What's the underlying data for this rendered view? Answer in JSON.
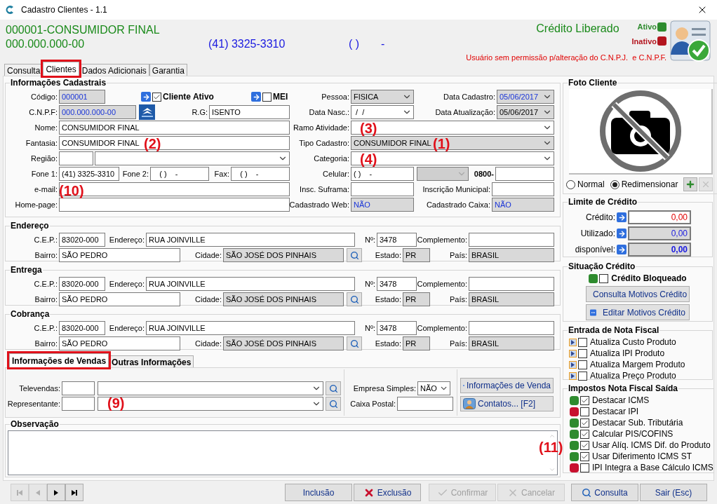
{
  "window": {
    "title": "Cadastro Clientes  - 1.1"
  },
  "header": {
    "customer": "000001-CONSUMIDOR FINAL",
    "document": "000.000.000-00",
    "phone": "(41) 3325-3310",
    "phone_2": "( )",
    "phone_2_separator": "-",
    "credit_status": "Crédito Liberado",
    "legend": [
      {
        "label": "Ativo",
        "color": "#2e8b2e"
      },
      {
        "label": "Inativo",
        "color": "#b3141e"
      }
    ],
    "warning": "Usuário sem permissão p/alteração do C.N.P.J.  e C.N.P.F."
  },
  "tabs": [
    {
      "label": "Consulta",
      "selected": false,
      "highlighted": false
    },
    {
      "label": "Clientes",
      "selected": true,
      "highlighted": true
    },
    {
      "label": "Dados Adicionais",
      "selected": false,
      "highlighted": false
    },
    {
      "label": "Garantia",
      "selected": false,
      "highlighted": false
    }
  ],
  "registration": {
    "title": "Informações Cadastrais",
    "lines": [
      {
        "fields": [
          {
            "kind": "text",
            "label": "Código:",
            "value": "000001",
            "readonly": true,
            "highlighted": true
          },
          {
            "kind": "check",
            "label": "Cliente Ativo",
            "checked": true
          },
          {
            "kind": "check",
            "label": "MEI",
            "checked": false
          },
          {
            "kind": "combo",
            "label": "Pessoa:",
            "value": "FISICA",
            "readonly": true,
            "highlighted": false
          },
          {
            "kind": "combo",
            "label": "Data Cadastro:",
            "value": "05/06/2017",
            "readonly": true,
            "highlighted": true
          }
        ]
      },
      {
        "fields": [
          {
            "kind": "text",
            "label": "C.N.P.F:",
            "value": "000.000.000-00",
            "readonly": true,
            "highlighted": true
          },
          {
            "kind": "icon_button"
          },
          {
            "kind": "text",
            "label": "R.G:",
            "value": "ISENTO",
            "readonly": false,
            "highlighted": false
          },
          {
            "kind": "combo",
            "label": "Data Nasc.:",
            "value": " /  /",
            "readonly": false,
            "highlighted": false
          },
          {
            "kind": "combo",
            "label": "Data Atualização:",
            "value": "05/06/2017",
            "readonly": true,
            "highlighted": false
          }
        ]
      },
      {
        "fields": [
          {
            "kind": "text",
            "label": "Nome:",
            "value": "CONSUMIDOR FINAL",
            "readonly": false,
            "highlighted": false
          },
          {
            "kind": "combo",
            "label": "Ramo Atividade:",
            "readonly": false
          }
        ]
      },
      {
        "fields": [
          {
            "kind": "text",
            "label": "Fantasia:",
            "value": "CONSUMIDOR FINAL",
            "readonly": false,
            "highlighted": false
          },
          {
            "kind": "combo",
            "label": "Tipo Cadastro:",
            "value": "CONSUMIDOR FINAL",
            "readonly": true,
            "highlighted": false
          }
        ]
      },
      {
        "fields": [
          {
            "kind": "text",
            "label": "Região:",
            "readonly": false
          },
          {
            "kind": "combo",
            "readonly": false
          },
          {
            "kind": "combo",
            "label": "Categoria:",
            "readonly": false
          }
        ]
      },
      {
        "fields": [
          {
            "kind": "text",
            "label": "Fone 1:",
            "value": "(41) 3325-3310",
            "readonly": false,
            "highlighted": false
          },
          {
            "kind": "text",
            "label": "Fone 2:",
            "value": "   ( )    -",
            "readonly": false,
            "highlighted": false
          },
          {
            "kind": "text",
            "label": "Fax:",
            "value": "   ( )    -",
            "readonly": false,
            "highlighted": false
          },
          {
            "kind": "text",
            "label": "Celular:",
            "value": "( )    -",
            "readonly": false,
            "highlighted": false
          },
          {
            "kind": "combo",
            "disabled": true
          },
          {
            "kind": "prefixed",
            "label": "0800-",
            "readonly": false
          }
        ]
      },
      {
        "fields": [
          {
            "kind": "text",
            "label": "e-mail:",
            "readonly": false
          },
          {
            "kind": "text",
            "label": "Insc. Suframa:",
            "readonly": false
          },
          {
            "kind": "text",
            "label": "Inscrição Municipal:",
            "readonly": false
          }
        ]
      },
      {
        "fields": [
          {
            "kind": "text",
            "label": "Home-page:",
            "readonly": false
          },
          {
            "kind": "text",
            "label": "Cadastrado Web:",
            "value": "NÃO",
            "readonly": true,
            "highlighted": true
          },
          {
            "kind": "text",
            "label": "Cadastrado Caixa:",
            "value": "NÃO",
            "readonly": true,
            "highlighted": true
          }
        ]
      }
    ]
  },
  "addresses": [
    {
      "title": "Endereço",
      "lines": [
        {
          "fields": [
            {
              "kind": "text",
              "label": "C.E.P.:",
              "value": "83020-000",
              "readonly": false,
              "highlighted": false
            },
            {
              "kind": "text",
              "label": "Endereço:",
              "value": "RUA JOINVILLE",
              "readonly": false,
              "highlighted": false
            },
            {
              "kind": "text",
              "label": "Nº:",
              "value": "3478",
              "readonly": false,
              "highlighted": false
            },
            {
              "kind": "text",
              "label": "Complemento:",
              "readonly": false
            }
          ]
        },
        {
          "fields": [
            {
              "kind": "text",
              "label": "Bairro:",
              "value": "SÃO PEDRO",
              "readonly": false,
              "highlighted": false
            },
            {
              "kind": "text",
              "label": "Cidade:",
              "value": "SÃO JOSÉ DOS PINHAIS",
              "readonly": true,
              "highlighted": false
            },
            {
              "kind": "search_button"
            },
            {
              "kind": "text",
              "label": "Estado:",
              "value": "PR",
              "readonly": true,
              "highlighted": false
            },
            {
              "kind": "text",
              "label": "País:",
              "value": "BRASIL",
              "readonly": true,
              "highlighted": false
            }
          ]
        }
      ]
    },
    {
      "title": "Entrega",
      "lines": [
        {
          "fields": [
            {
              "kind": "text",
              "label": "C.E.P.:",
              "value": "83020-000",
              "readonly": false,
              "highlighted": false
            },
            {
              "kind": "text",
              "label": "Endereço:",
              "value": "RUA JOINVILLE",
              "readonly": false,
              "highlighted": false
            },
            {
              "kind": "text",
              "label": "Nº:",
              "value": "3478",
              "readonly": false,
              "highlighted": false
            },
            {
              "kind": "text",
              "label": "Complemento:",
              "readonly": false
            }
          ]
        },
        {
          "fields": [
            {
              "kind": "text",
              "label": "Bairro:",
              "value": "SÃO PEDRO",
              "readonly": false,
              "highlighted": false
            },
            {
              "kind": "text",
              "label": "Cidade:",
              "value": "SÃO JOSÉ DOS PINHAIS",
              "readonly": true,
              "highlighted": false
            },
            {
              "kind": "search_button"
            },
            {
              "kind": "text",
              "label": "Estado:",
              "value": "PR",
              "readonly": true,
              "highlighted": false
            },
            {
              "kind": "text",
              "label": "País:",
              "value": "BRASIL",
              "readonly": true,
              "highlighted": false
            }
          ]
        }
      ]
    },
    {
      "title": "Cobrança",
      "lines": [
        {
          "fields": [
            {
              "kind": "text",
              "label": "C.E.P.:",
              "value": "83020-000",
              "readonly": false,
              "highlighted": false
            },
            {
              "kind": "text",
              "label": "Endereço:",
              "value": "RUA JOINVILLE",
              "readonly": false,
              "highlighted": false
            },
            {
              "kind": "text",
              "label": "Nº:",
              "value": "3478",
              "readonly": false,
              "highlighted": false
            },
            {
              "kind": "text",
              "label": "Complemento:",
              "readonly": false
            }
          ]
        },
        {
          "fields": [
            {
              "kind": "text",
              "label": "Bairro:",
              "value": "SÃO PEDRO",
              "readonly": false,
              "highlighted": false
            },
            {
              "kind": "text",
              "label": "Cidade:",
              "value": "SÃO JOSÉ DOS PINHAIS",
              "readonly": true,
              "highlighted": false
            },
            {
              "kind": "search_button"
            },
            {
              "kind": "text",
              "label": "Estado:",
              "value": "PR",
              "readonly": true,
              "highlighted": false
            },
            {
              "kind": "text",
              "label": "País:",
              "value": "BRASIL",
              "readonly": true,
              "highlighted": false
            }
          ]
        }
      ]
    }
  ],
  "sales_tabs": [
    {
      "label": "Informações de Vendas",
      "selected": true,
      "highlighted": true
    },
    {
      "label": "Outras Informações",
      "selected": false,
      "highlighted": false
    }
  ],
  "sales": {
    "lines": [
      {
        "fields": [
          {
            "kind": "text",
            "label": "Televendas:",
            "readonly": false
          },
          {
            "kind": "combo",
            "readonly": false
          },
          {
            "kind": "search_button"
          }
        ]
      },
      {
        "fields": [
          {
            "kind": "text",
            "label": "Representante:",
            "readonly": false
          },
          {
            "kind": "combo",
            "readonly": false
          },
          {
            "kind": "search_button"
          }
        ]
      }
    ],
    "options": [
      {
        "kind": "combo",
        "label": "Empresa Simples:",
        "value": "NÃO",
        "readonly": false,
        "highlighted": false
      },
      {
        "kind": "text",
        "label": "Caixa Postal:",
        "readonly": false
      }
    ],
    "buttons": [
      {
        "label": "Informações de Venda",
        "kind": "info"
      },
      {
        "label": "Contatos... [F2]",
        "kind": "contacts"
      }
    ]
  },
  "notes": {
    "title": "Observação"
  },
  "photo": {
    "title": "Foto Cliente",
    "modes": [
      {
        "label": "Normal",
        "selected": false
      },
      {
        "label": "Redimensionar",
        "selected": true
      }
    ]
  },
  "credit_limit": {
    "title": "Limite de Crédito",
    "rows": [
      {
        "label": "Crédito:",
        "value": "0,00",
        "kind": "editable"
      },
      {
        "label": "Utilizado:",
        "value": "0,00",
        "kind": "used"
      },
      {
        "label": "disponível:",
        "value": "0,00",
        "kind": "total"
      }
    ]
  },
  "credit_status": {
    "title": "Situação Crédito",
    "color": "#2e8b2e",
    "label": "Crédito Bloqueado",
    "checked": false,
    "buttons": [
      {
        "label": "Consulta Motivos Crédito",
        "kind": "search"
      },
      {
        "label": "Editar Motivos Crédito",
        "kind": "edit"
      }
    ]
  },
  "invoice_entry": {
    "title": "Entrada de Nota Fiscal",
    "items": [
      {
        "label": "Atualiza Custo Produto",
        "checked": false
      },
      {
        "label": "Atualiza IPI Produto",
        "checked": false
      },
      {
        "label": "Atualiza Margem Produto",
        "checked": false
      },
      {
        "label": "Atualiza Preço Produto",
        "checked": false
      }
    ]
  },
  "invoice_taxes": {
    "title": "Impostos Nota Fiscal Saída",
    "items": [
      {
        "label": "Destacar ICMS",
        "checked": true,
        "color": "#2e8b2e"
      },
      {
        "label": "Destacar IPI",
        "checked": false,
        "color": "#c8102e"
      },
      {
        "label": "Destacar Sub. Tributária",
        "checked": true,
        "color": "#2e8b2e"
      },
      {
        "label": "Calcular PIS/COFINS",
        "checked": true,
        "color": "#2e8b2e"
      },
      {
        "label": "Usar Alíq. ICMS Dif. do Produto",
        "checked": true,
        "color": "#2e8b2e"
      },
      {
        "label": "Usar Diferimento ICMS ST",
        "checked": true,
        "color": "#2e8b2e"
      },
      {
        "label": "IPI Integra a Base Cálculo ICMS",
        "checked": false,
        "color": "#c8102e"
      }
    ]
  },
  "navigation": [
    {
      "kind": "first",
      "disabled": true
    },
    {
      "kind": "previous",
      "disabled": true
    },
    {
      "kind": "next",
      "disabled": false
    },
    {
      "kind": "last",
      "disabled": false
    }
  ],
  "actions": [
    {
      "label": "Inclusão",
      "kind": "plain",
      "disabled": false
    },
    {
      "label": "Exclusão",
      "kind": "delete",
      "disabled": false
    },
    {
      "label": "Confirmar",
      "kind": "confirm",
      "disabled": true
    },
    {
      "label": "Cancelar",
      "kind": "cancel",
      "disabled": true
    },
    {
      "label": "Consulta",
      "kind": "search",
      "disabled": false
    },
    {
      "label": "Sair (Esc)",
      "kind": "plain",
      "disabled": false
    }
  ],
  "annotations": [
    {
      "label": "(3)"
    },
    {
      "label": "(2)"
    },
    {
      "label": "(1)"
    },
    {
      "label": "(4)"
    },
    {
      "label": "(10)"
    },
    {
      "label": "(9)"
    },
    {
      "label": "(11)"
    }
  ]
}
